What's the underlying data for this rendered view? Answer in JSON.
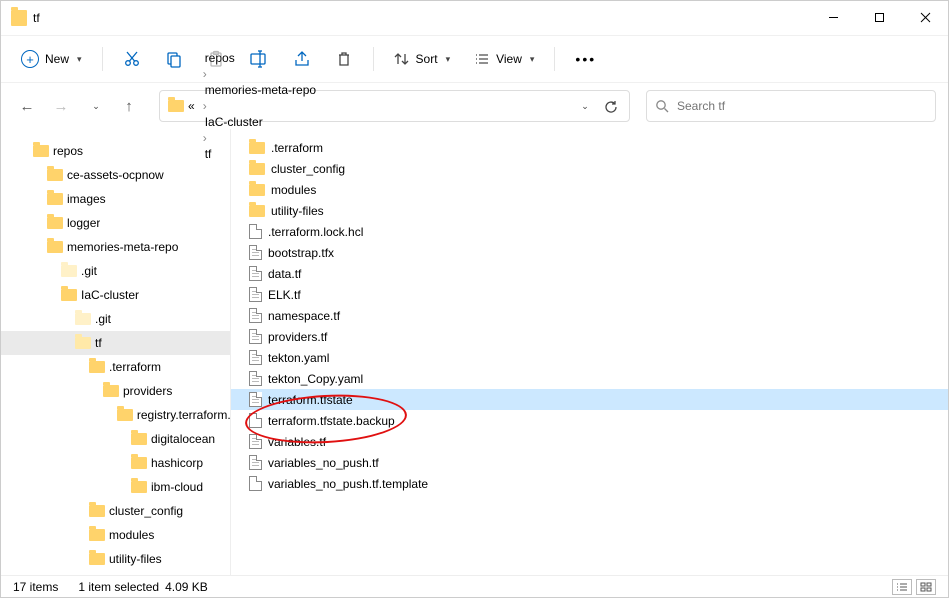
{
  "window": {
    "title": "tf"
  },
  "toolbar": {
    "new": "New",
    "sort": "Sort",
    "view": "View"
  },
  "breadcrumb": {
    "root_glyph": "«",
    "segments": [
      "repos",
      "memories-meta-repo",
      "IaC-cluster",
      "tf"
    ]
  },
  "search": {
    "placeholder": "Search tf"
  },
  "tree": [
    {
      "label": "repos",
      "depth": 0,
      "kind": "folder"
    },
    {
      "label": "ce-assets-ocpnow",
      "depth": 1,
      "kind": "folder"
    },
    {
      "label": "images",
      "depth": 1,
      "kind": "folder"
    },
    {
      "label": "logger",
      "depth": 1,
      "kind": "folder"
    },
    {
      "label": "memories-meta-repo",
      "depth": 1,
      "kind": "folder"
    },
    {
      "label": ".git",
      "depth": 2,
      "kind": "folder-dim"
    },
    {
      "label": "IaC-cluster",
      "depth": 2,
      "kind": "folder"
    },
    {
      "label": ".git",
      "depth": 3,
      "kind": "folder-dim"
    },
    {
      "label": "tf",
      "depth": 3,
      "kind": "folder-sel",
      "selected": true
    },
    {
      "label": ".terraform",
      "depth": 4,
      "kind": "folder"
    },
    {
      "label": "providers",
      "depth": 5,
      "kind": "folder"
    },
    {
      "label": "registry.terraform.",
      "depth": 6,
      "kind": "folder"
    },
    {
      "label": "digitalocean",
      "depth": 7,
      "kind": "folder"
    },
    {
      "label": "hashicorp",
      "depth": 7,
      "kind": "folder"
    },
    {
      "label": "ibm-cloud",
      "depth": 7,
      "kind": "folder"
    },
    {
      "label": "cluster_config",
      "depth": 4,
      "kind": "folder"
    },
    {
      "label": "modules",
      "depth": 4,
      "kind": "folder"
    },
    {
      "label": "utility-files",
      "depth": 4,
      "kind": "folder"
    }
  ],
  "files": [
    {
      "name": ".terraform",
      "kind": "folder"
    },
    {
      "name": "cluster_config",
      "kind": "folder"
    },
    {
      "name": "modules",
      "kind": "folder"
    },
    {
      "name": "utility-files",
      "kind": "folder"
    },
    {
      "name": ".terraform.lock.hcl",
      "kind": "file"
    },
    {
      "name": "bootstrap.tfx",
      "kind": "file-lines"
    },
    {
      "name": "data.tf",
      "kind": "file-lines"
    },
    {
      "name": "ELK.tf",
      "kind": "file-lines"
    },
    {
      "name": "namespace.tf",
      "kind": "file-lines"
    },
    {
      "name": "providers.tf",
      "kind": "file-lines"
    },
    {
      "name": "tekton.yaml",
      "kind": "file-lines"
    },
    {
      "name": "tekton_Copy.yaml",
      "kind": "file-lines"
    },
    {
      "name": "terraform.tfstate",
      "kind": "file-lines",
      "selected": true
    },
    {
      "name": "terraform.tfstate.backup",
      "kind": "file"
    },
    {
      "name": "variables.tf",
      "kind": "file-lines"
    },
    {
      "name": "variables_no_push.tf",
      "kind": "file-lines"
    },
    {
      "name": "variables_no_push.tf.template",
      "kind": "file"
    }
  ],
  "status": {
    "count": "17 items",
    "selection": "1 item selected",
    "size": "4.09 KB"
  }
}
